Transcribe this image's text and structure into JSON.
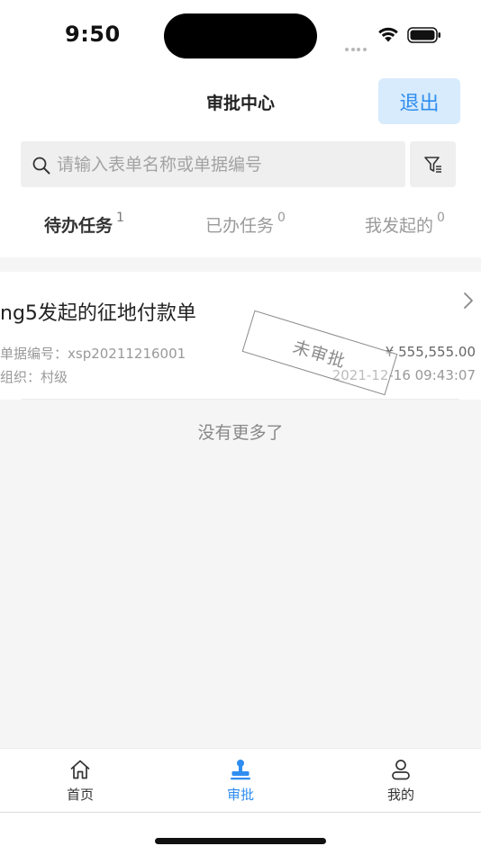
{
  "status_bar": {
    "time": "9:50"
  },
  "nav": {
    "title": "审批中心",
    "logout_label": "退出"
  },
  "search": {
    "placeholder": "请输入表单名称或单据编号",
    "value": ""
  },
  "tabs": [
    {
      "label": "待办任务",
      "count": "1",
      "active": true
    },
    {
      "label": "已办任务",
      "count": "0",
      "active": false
    },
    {
      "label": "我发起的",
      "count": "0",
      "active": false
    }
  ],
  "items": [
    {
      "title": "ng5发起的征地付款单",
      "doc_no": "单据编号：xsp20211216001",
      "org": "组织：村级",
      "amount": "¥ 555,555.00",
      "date": "2021-12-16 09:43:07",
      "stamp": "未审批"
    }
  ],
  "list_footer": "没有更多了",
  "tabbar": [
    {
      "label": "首页",
      "icon": "home-icon",
      "active": false
    },
    {
      "label": "审批",
      "icon": "stamp-icon",
      "active": true
    },
    {
      "label": "我的",
      "icon": "user-icon",
      "active": false
    }
  ],
  "colors": {
    "accent": "#2f8df0",
    "accent_light": "#d7ebfc"
  }
}
